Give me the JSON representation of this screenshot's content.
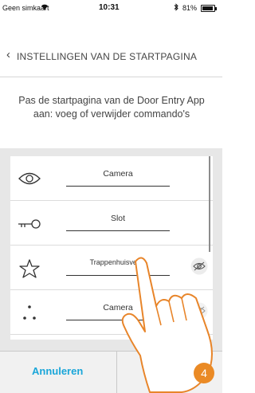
{
  "status_bar": {
    "carrier": "Geen simkaart",
    "wifi_icon": "wifi-icon",
    "time": "10:31",
    "bluetooth_icon": "bluetooth-icon",
    "battery_percent": "81%",
    "battery_level": 0.81
  },
  "nav": {
    "back_icon": "‹",
    "title": "INSTELLINGEN VAN DE STARTPAGINA"
  },
  "description": "Pas de startpagina van de Door Entry App aan: voeg of verwijder commando's",
  "items": [
    {
      "icon": "eye-icon",
      "label": "Camera",
      "visibility_toggle": false
    },
    {
      "icon": "key-icon",
      "label": "Slot",
      "visibility_toggle": false
    },
    {
      "icon": "star-icon",
      "label": "Trappenhuisverlic",
      "visibility_toggle": true,
      "visibility_icon": "eye-off-icon"
    },
    {
      "icon": "dots-icon",
      "label": "Camera",
      "visibility_toggle": true,
      "visibility_icon": "eye-off-icon"
    }
  ],
  "bottom_bar": {
    "cancel_label": "Annuleren",
    "next_label": "›"
  },
  "step_badge": "4",
  "colors": {
    "accent": "#1aa6d9",
    "badge": "#ea8a25",
    "list_background": "#e7e7e7"
  }
}
